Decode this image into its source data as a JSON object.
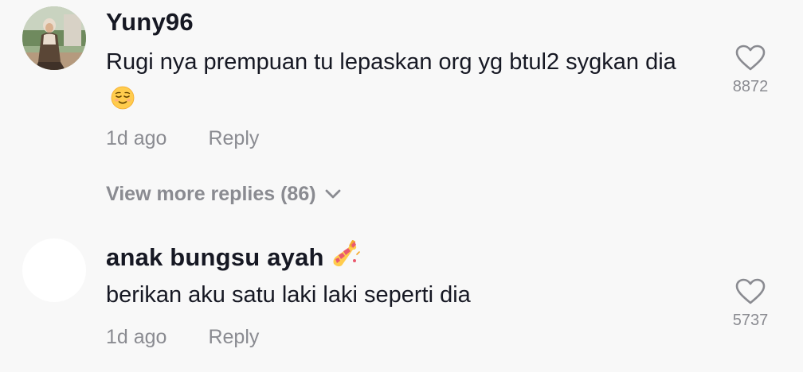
{
  "comments": [
    {
      "username": "Yuny96",
      "text": "Rugi nya prempuan tu lepaskan org yg btul2 sygkan dia",
      "text_emoji": "relieved-face-emoji",
      "time": "1d ago",
      "reply_label": "Reply",
      "like_count": "8872",
      "avatar": "user-photo-avatar"
    },
    {
      "username": "anak bungsu ayah",
      "username_emoji": "nail-polish-emoji",
      "text": "berikan aku satu laki laki seperti dia",
      "time": "1d ago",
      "reply_label": "Reply",
      "like_count": "5737",
      "avatar": "blank-avatar"
    }
  ],
  "view_more_replies": "View more replies (86)",
  "colors": {
    "background": "#f8f8f8",
    "primary_text": "#161823",
    "secondary_text": "#8a8b91",
    "heart_outline": "#8a8b91"
  }
}
